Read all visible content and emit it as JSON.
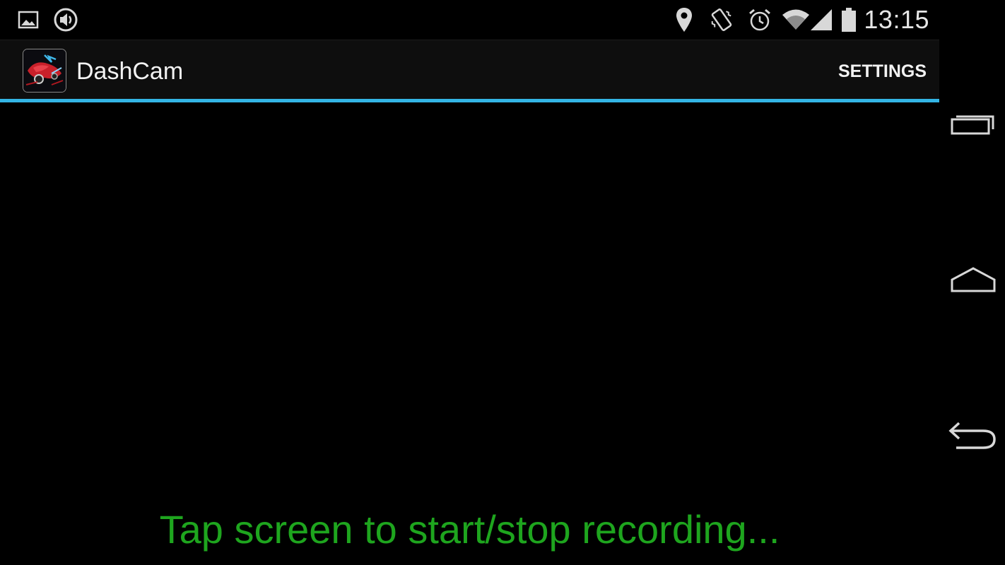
{
  "status_bar": {
    "time": "13:15",
    "left_icons": [
      "image-notification-icon",
      "volume-notification-icon"
    ],
    "right_icons": [
      "location-icon",
      "vibrate-icon",
      "alarm-icon",
      "wifi-icon",
      "signal-icon",
      "battery-icon"
    ]
  },
  "action_bar": {
    "title": "DashCam",
    "settings_label": "SETTINGS",
    "app_icon": "dashcam-app-icon"
  },
  "main": {
    "hint_text": "Tap screen to start/stop recording..."
  },
  "nav_bar": {
    "buttons": [
      "recent-apps-icon",
      "home-icon",
      "back-icon"
    ]
  },
  "colors": {
    "background": "#000000",
    "action_bar_bg": "#0e0e0e",
    "accent": "#33b5e5",
    "hint_text": "#1ea51e",
    "icon": "#d8d8d8"
  }
}
